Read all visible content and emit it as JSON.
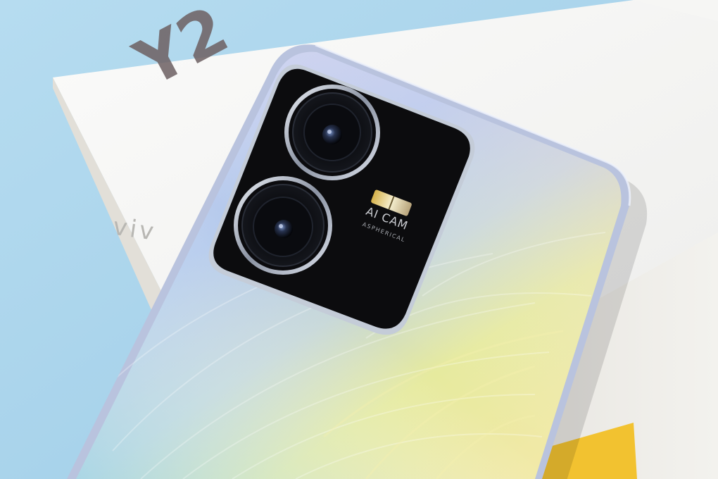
{
  "photo": {
    "box_print": {
      "model_text": "Y2",
      "brand_text": "viv"
    },
    "camera_module": {
      "label": "AI CAM",
      "sublabel": "ASPHERICAL"
    }
  },
  "colors": {
    "background_blue": "#a9d3ea",
    "box_white": "#f4f4f2",
    "box_side": "#e6e3dc",
    "phone_gradient_blue": "#b9cdea",
    "phone_gradient_yellow": "#e9ec9c",
    "camera_black": "#0c0c0e",
    "yellow_prop": "#f2c230"
  }
}
